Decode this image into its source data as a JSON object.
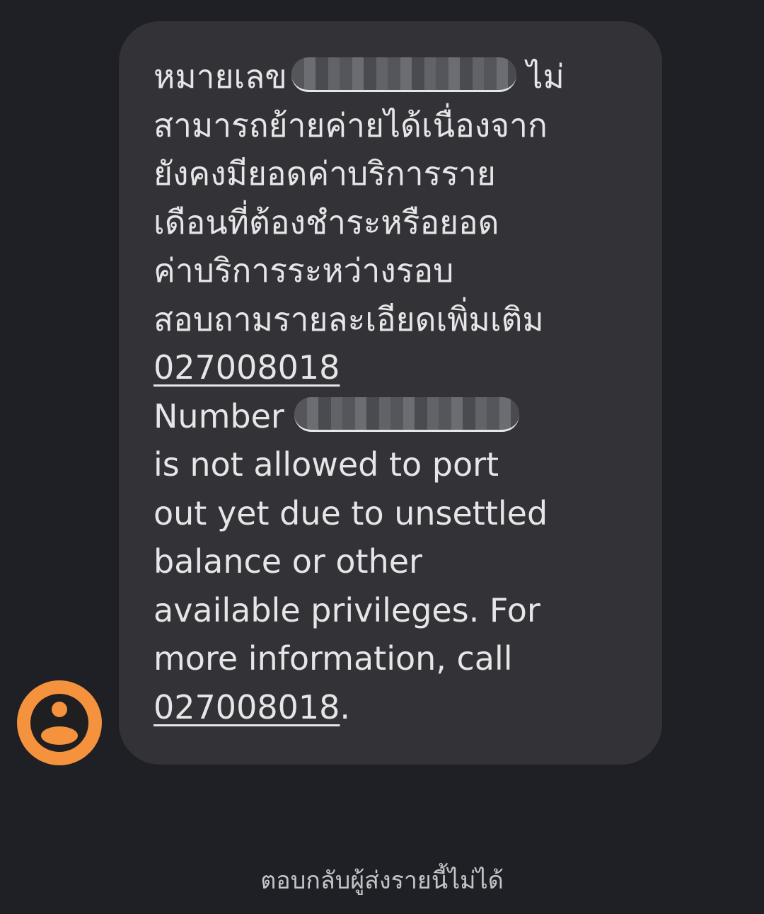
{
  "message": {
    "thai_line_1_prefix": "หมายเลข",
    "thai_line_1_suffix": "ไม่",
    "thai_line_2": "สามารถย้ายค่ายได้เนื่องจาก",
    "thai_line_3": "ยังคงมียอดค่าบริการราย",
    "thai_line_4": "เดือนที่ต้องชำระหรือยอด",
    "thai_line_5": "ค่าบริการระหว่างรอบ",
    "thai_line_6": "สอบถามรายละเอียดเพิ่มเติม",
    "thai_phone": "027008018",
    "en_number_label": "Number",
    "en_line_2": "is not allowed to port",
    "en_line_3": "out yet due to unsettled",
    "en_line_4": "balance or other",
    "en_line_5": "available privileges. For",
    "en_line_6": "more information, call",
    "en_phone": "027008018",
    "en_phone_period": "."
  },
  "sender": {
    "avatar_icon": "person-icon",
    "avatar_color": "#f5923e"
  },
  "footer": {
    "notice": "ตอบกลับผู้ส่งรายนี้ไม่ได้"
  },
  "colors": {
    "background": "#1f2026",
    "bubble": "#333337",
    "text": "#e6e6e8"
  }
}
